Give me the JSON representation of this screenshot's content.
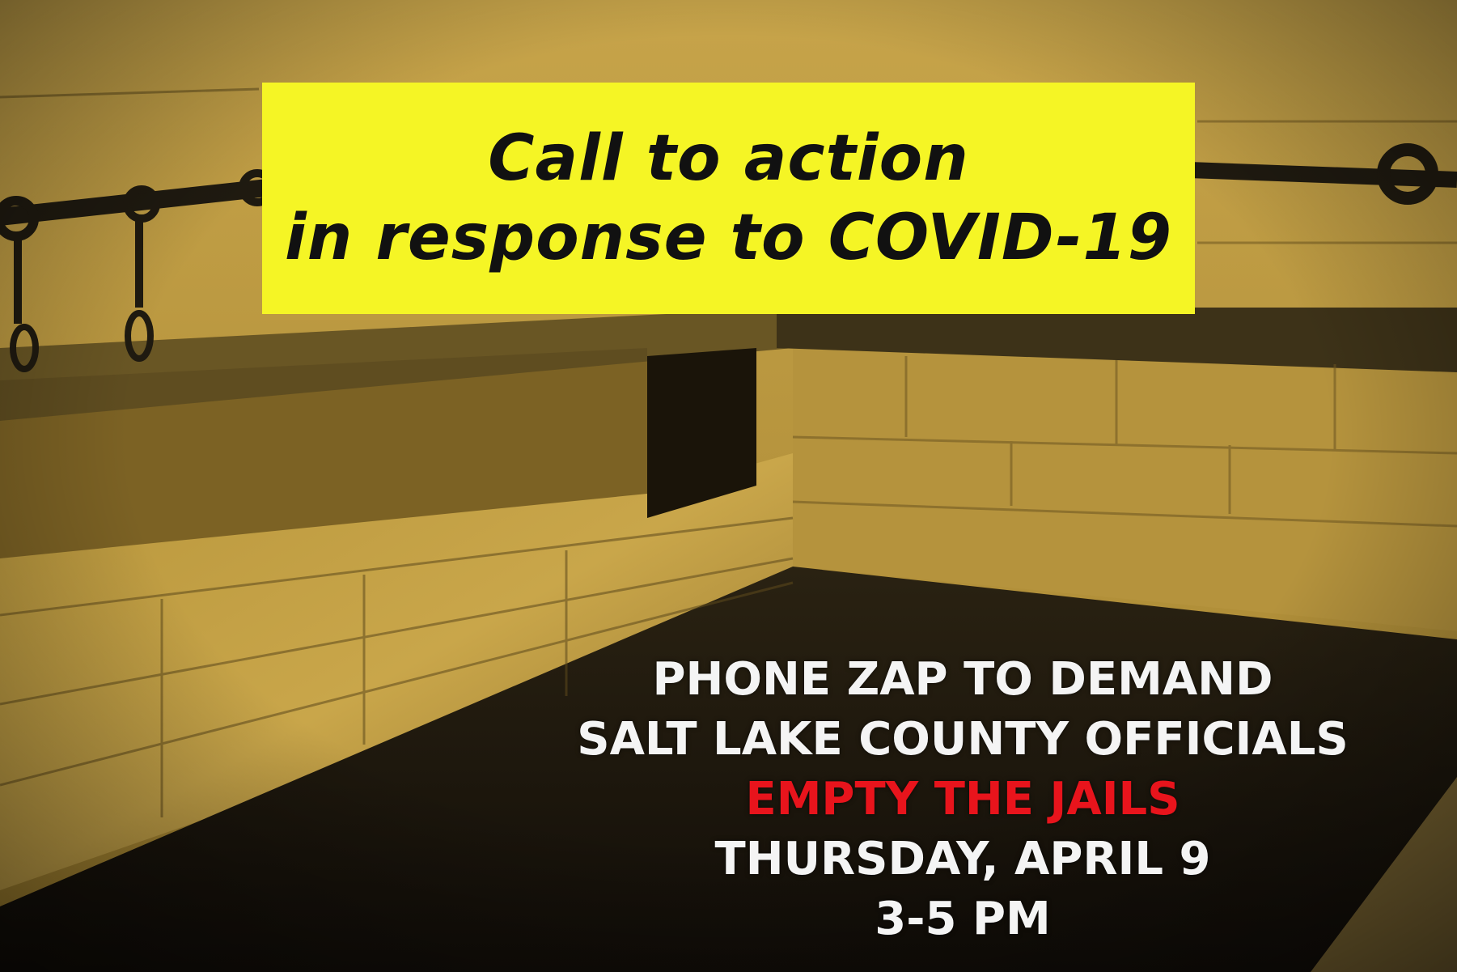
{
  "headline": {
    "line1": "Call to action",
    "line2": "in response to COVID-19",
    "background_color": "#f5f525"
  },
  "event": {
    "line1": "PHONE ZAP TO DEMAND",
    "line2": "SALT LAKE COUNTY OFFICIALS",
    "line3": "EMPTY THE JAILS",
    "date": "THURSDAY, APRIL 9",
    "time": "3-5 PM",
    "highlight_color": "#e8141c"
  },
  "background": {
    "icon": "jail-cell-photo",
    "tone": "sepia"
  }
}
